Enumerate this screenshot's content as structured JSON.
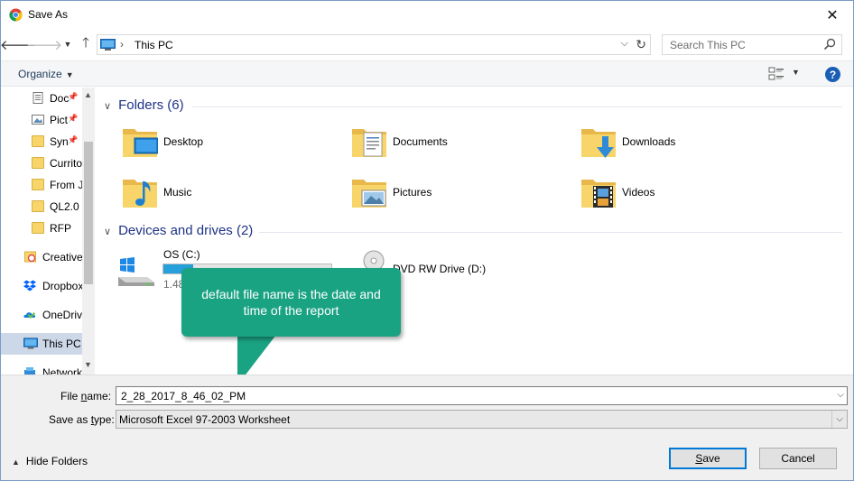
{
  "window": {
    "title": "Save As",
    "close_label": "✕"
  },
  "nav": {
    "breadcrumb_sep": "›",
    "location": "This PC",
    "search_placeholder": "Search This PC"
  },
  "toolbar": {
    "organize_label": "Organize",
    "help_label": "?"
  },
  "sidebar": {
    "items": [
      {
        "label": "Doc",
        "pinned": "📌"
      },
      {
        "label": "Pict",
        "pinned": "📌"
      },
      {
        "label": "Syn",
        "pinned": "📌"
      },
      {
        "label": "Currito"
      },
      {
        "label": "From J"
      },
      {
        "label": "QL2.0"
      },
      {
        "label": "RFP"
      },
      {
        "label": "Creative"
      },
      {
        "label": "Dropbox"
      },
      {
        "label": "OneDriv"
      },
      {
        "label": "This PC"
      },
      {
        "label": "Network"
      }
    ]
  },
  "content": {
    "folders_header": "Folders (6)",
    "folders": [
      {
        "label": "Desktop",
        "overlay": "desktop-icon"
      },
      {
        "label": "Documents",
        "overlay": "document-icon"
      },
      {
        "label": "Downloads",
        "overlay": "download-arrow-icon"
      },
      {
        "label": "Music",
        "overlay": "music-note-icon"
      },
      {
        "label": "Pictures",
        "overlay": "picture-icon"
      },
      {
        "label": "Videos",
        "overlay": "film-icon"
      }
    ],
    "drives_header": "Devices and drives (2)",
    "drives": [
      {
        "label": "OS (C:)",
        "sub": "1.48",
        "fill_fraction": 0.18
      },
      {
        "label": "DVD RW Drive (D:)"
      }
    ]
  },
  "callout": {
    "text": "default file name is the date and time of the report"
  },
  "form": {
    "file_name_label_pre": "File ",
    "file_name_label_u": "n",
    "file_name_label_post": "ame:",
    "file_name_value": "2_28_2017_8_46_02_PM",
    "save_type_label_pre": "Save as ",
    "save_type_label_u": "t",
    "save_type_label_post": "ype:",
    "save_type_value": "Microsoft Excel 97-2003 Worksheet",
    "hide_folders_label": "Hide Folders",
    "save_label_u": "S",
    "save_label_post": "ave",
    "cancel_label": "Cancel"
  },
  "colors": {
    "accent": "#0078d7",
    "callout": "#1aa383",
    "header_text": "#1e3287",
    "drive_fill": "#26a0da",
    "folder": "#f7d56a"
  }
}
